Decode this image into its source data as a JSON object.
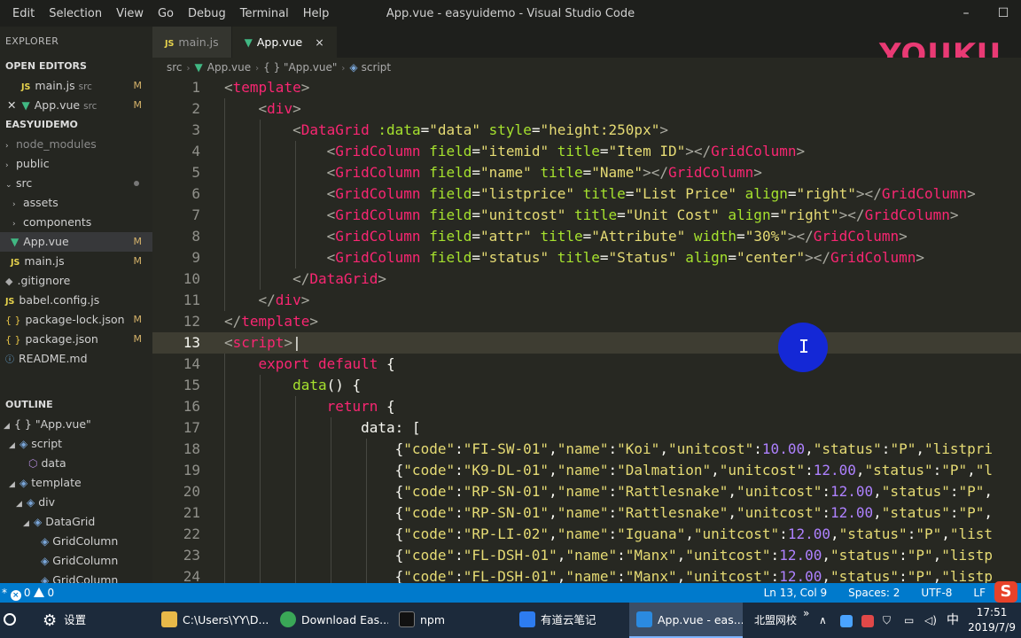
{
  "titlebar": {
    "menu": [
      "Edit",
      "Selection",
      "View",
      "Go",
      "Debug",
      "Terminal",
      "Help"
    ],
    "title": "App.vue - easyuidemo - Visual Studio Code",
    "minimize": "–",
    "maximize": "☐"
  },
  "explorer": {
    "header": "EXPLORER",
    "open_editors_title": "OPEN EDITORS",
    "open_editors": [
      {
        "name": "main.js",
        "sub": "src",
        "badge": "M",
        "icon": "js-file-icon"
      },
      {
        "name": "App.vue",
        "sub": "src",
        "badge": "M",
        "icon": "vue-file-icon"
      }
    ],
    "project_title": "EASYUIDEMO",
    "tree": [
      {
        "name": "node_modules",
        "caret": "›"
      },
      {
        "name": "public",
        "caret": "›"
      },
      {
        "name": "src",
        "caret": "⌄"
      },
      {
        "name": "assets",
        "caret": "›"
      },
      {
        "name": "components",
        "caret": "›"
      },
      {
        "name": "App.vue",
        "badge": "M"
      },
      {
        "name": "main.js",
        "badge": "M"
      },
      {
        "name": ".gitignore"
      },
      {
        "name": "babel.config.js"
      },
      {
        "name": "package-lock.json",
        "badge": "M"
      },
      {
        "name": "package.json",
        "badge": "M"
      },
      {
        "name": "README.md"
      }
    ],
    "js_label": "JS",
    "json_label": "{ }"
  },
  "outline": {
    "title": "OUTLINE",
    "items": [
      {
        "label": "{ } \"App.vue\""
      },
      {
        "label": "script"
      },
      {
        "label": "data"
      },
      {
        "label": "template"
      },
      {
        "label": "div"
      },
      {
        "label": "DataGrid"
      },
      {
        "label": "GridColumn"
      },
      {
        "label": "GridColumn"
      },
      {
        "label": "GridColumn"
      }
    ]
  },
  "tabs": [
    {
      "label": "main.js",
      "icon": "JS"
    },
    {
      "label": "App.vue",
      "icon": "V",
      "close": "×"
    }
  ],
  "watermark": "YOUKU",
  "breadcrumb": [
    "src",
    "App.vue",
    "{ } \"App.vue\"",
    "script"
  ],
  "editor": {
    "line_numbers": [
      "1",
      "2",
      "3",
      "4",
      "5",
      "6",
      "7",
      "8",
      "9",
      "10",
      "11",
      "12",
      "13",
      "14",
      "15",
      "16",
      "17",
      "18",
      "19",
      "20",
      "21",
      "22",
      "23",
      "24"
    ],
    "current_line": 13
  },
  "statusbar": {
    "errors": "0",
    "warnings": "0",
    "position": "Ln 13, Col 9",
    "spaces": "Spaces: 2",
    "encoding": "UTF-8",
    "eol": "LF",
    "ime": "S"
  },
  "taskbar": {
    "settings": "设置",
    "explorer": "C:\\Users\\YY\\D...",
    "chrome": "Download Eas...",
    "npm": "npm",
    "youdao": "有道云笔记",
    "vscode": "App.vue - eas...",
    "network": "北盟网校",
    "ime": "中",
    "time": "17:51",
    "date": "2019/7/9",
    "expand": "»",
    "tray_up": "∧"
  },
  "colors": {
    "statusbar": "#007acc",
    "editor_bg": "#272822",
    "sidebar_bg": "#252621",
    "watermark": "#e93a74"
  }
}
